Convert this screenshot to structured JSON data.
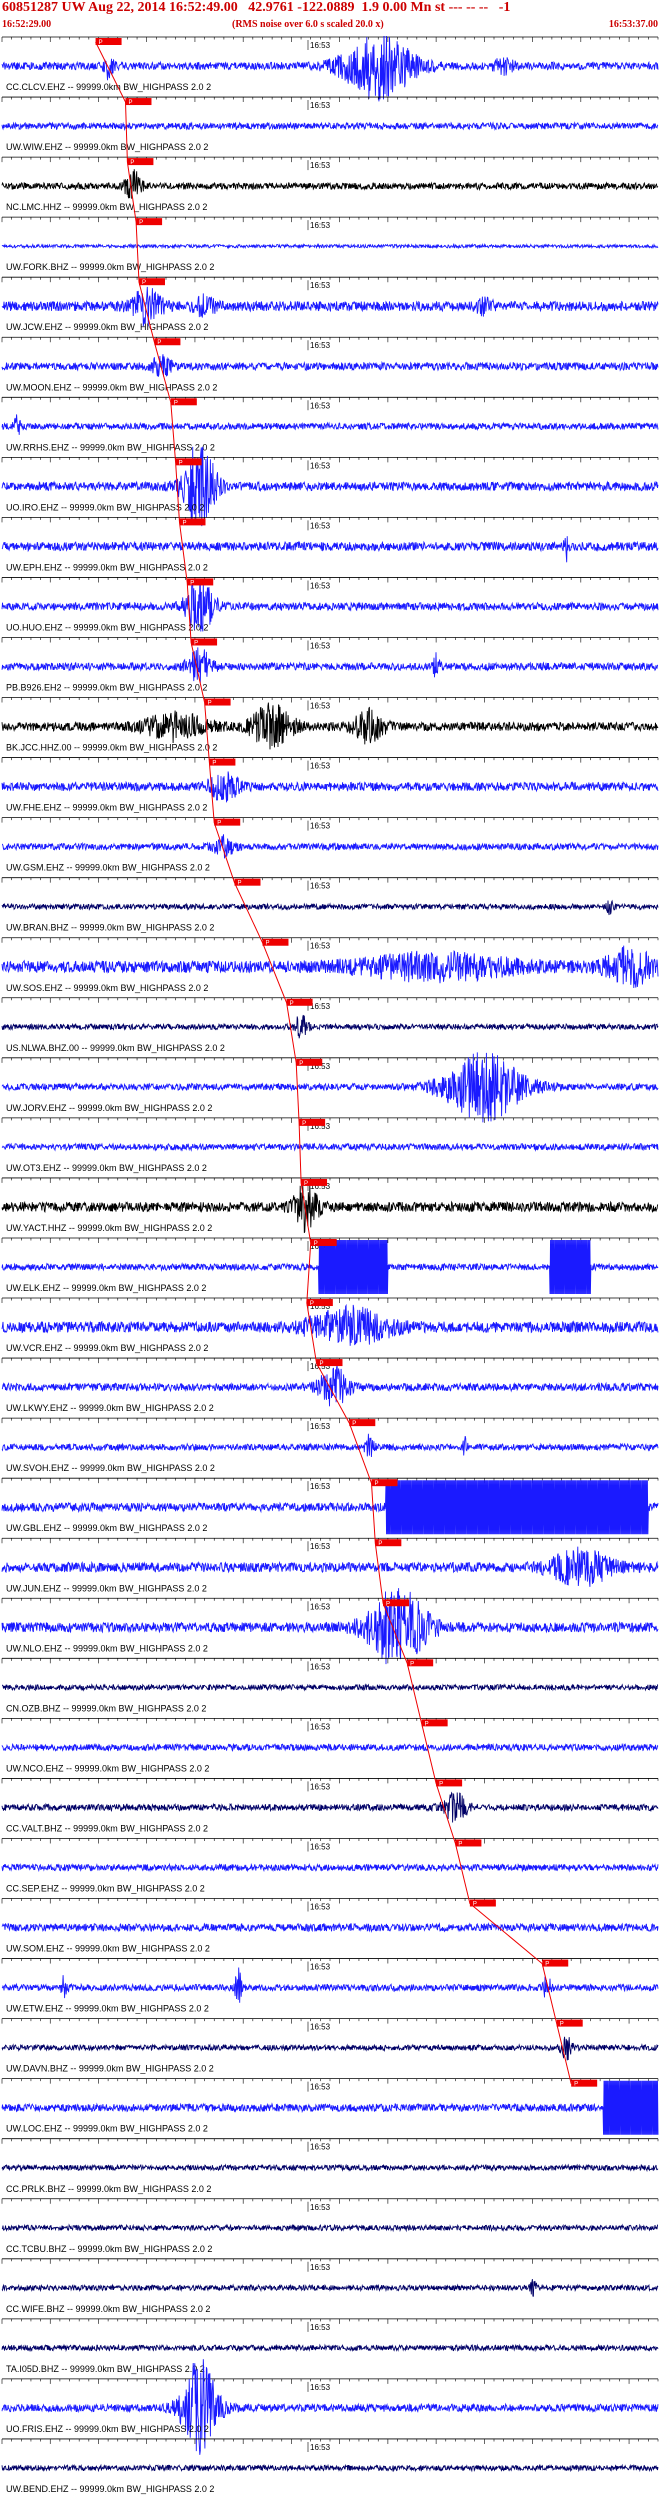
{
  "header": {
    "title": "60851287 UW Aug 22, 2014 16:52:49.00   42.9761 -122.0889  1.9 0.00 Mn st --- -- --   -1",
    "start_time": "16:52:29.00",
    "rms_note": "(RMS noise over 6.0 s scaled 20.0 x)",
    "end_time": "16:53:37.00"
  },
  "chart_data": {
    "type": "line",
    "title": "60851287 UW Aug 22, 2014 16:52:49.00   42.9761 -122.0889  1.9 0.00 Mn st --- -- --   -1",
    "x_start": "16:52:29.00",
    "x_end": "16:53:37.00",
    "x_duration_s": 68,
    "x_mid_label": "16:53",
    "pick_label": "P",
    "filter_label": "-- 99999.0km BW_HIGHPASS  2.0  2",
    "colors": {
      "blue": "#1a1aff",
      "black": "#000000",
      "navy": "#000066",
      "pick": "#ee0000"
    },
    "stations": [
      {
        "name": "CC.CLCV.EHZ",
        "pick_s": 9.7,
        "color": "#1a1aff",
        "amp": 0.35,
        "events": [
          {
            "t": 11,
            "a": 1.0,
            "w": 0.5
          },
          {
            "t": 39,
            "a": 3.0,
            "w": 3.5
          },
          {
            "t": 52,
            "a": 0.6,
            "w": 1
          }
        ]
      },
      {
        "name": "UW.WIW.EHZ",
        "pick_s": 12.8,
        "color": "#1a1aff",
        "amp": 0.3,
        "events": []
      },
      {
        "name": "NC.LMC.HHZ",
        "pick_s": 13.0,
        "color": "#000000",
        "amp": 0.3,
        "events": [
          {
            "t": 13.6,
            "a": 1.4,
            "w": 0.8
          }
        ]
      },
      {
        "name": "UW.FORK.BHZ",
        "pick_s": 13.9,
        "color": "#1a1aff",
        "amp": 0.15,
        "events": []
      },
      {
        "name": "UW.JCW.EHZ",
        "pick_s": 14.2,
        "color": "#1a1aff",
        "amp": 0.45,
        "events": [
          {
            "t": 15,
            "a": 1.5,
            "w": 1.5
          },
          {
            "t": 21,
            "a": 0.8,
            "w": 1
          },
          {
            "t": 50,
            "a": 0.6,
            "w": 0.8
          }
        ]
      },
      {
        "name": "UW.MOON.EHZ",
        "pick_s": 15.8,
        "color": "#1a1aff",
        "amp": 0.35,
        "events": [
          {
            "t": 16.5,
            "a": 0.8,
            "w": 1
          }
        ]
      },
      {
        "name": "UW.RRHS.EHZ",
        "pick_s": 17.5,
        "color": "#1a1aff",
        "amp": 0.3,
        "events": [
          {
            "t": 1.5,
            "a": 1.2,
            "w": 0.3
          }
        ]
      },
      {
        "name": "UO.IRO.EHZ",
        "pick_s": 18.0,
        "color": "#1a1aff",
        "amp": 0.4,
        "events": [
          {
            "t": 20.5,
            "a": 4.0,
            "w": 1.6
          }
        ]
      },
      {
        "name": "UW.EPH.EHZ",
        "pick_s": 18.4,
        "color": "#1a1aff",
        "amp": 0.4,
        "events": [
          {
            "t": 58.5,
            "a": 1.5,
            "w": 0.2
          }
        ]
      },
      {
        "name": "UO.HUO.EHZ",
        "pick_s": 19.2,
        "color": "#1a1aff",
        "amp": 0.35,
        "events": [
          {
            "t": 20.5,
            "a": 2.2,
            "w": 1.5
          }
        ]
      },
      {
        "name": "PB.B926.EH2",
        "pick_s": 19.6,
        "color": "#1a1aff",
        "amp": 0.35,
        "events": [
          {
            "t": 20.5,
            "a": 1.5,
            "w": 1.2
          },
          {
            "t": 45,
            "a": 1.2,
            "w": 0.3
          }
        ]
      },
      {
        "name": "BK.JCC.HHZ.00",
        "pick_s": 21.0,
        "color": "#000000",
        "amp": 0.4,
        "events": [
          {
            "t": 18,
            "a": 1.2,
            "w": 3
          },
          {
            "t": 28,
            "a": 2.0,
            "w": 2
          },
          {
            "t": 38,
            "a": 1.4,
            "w": 1.5
          }
        ]
      },
      {
        "name": "UW.FHE.EHZ",
        "pick_s": 21.5,
        "color": "#1a1aff",
        "amp": 0.4,
        "events": [
          {
            "t": 23,
            "a": 1.2,
            "w": 1.5
          }
        ]
      },
      {
        "name": "UW.GSM.EHZ",
        "pick_s": 22.0,
        "color": "#1a1aff",
        "amp": 0.3,
        "events": [
          {
            "t": 23,
            "a": 0.9,
            "w": 1
          }
        ]
      },
      {
        "name": "UW.BRAN.BHZ",
        "pick_s": 24.1,
        "color": "#000066",
        "amp": 0.25,
        "events": [
          {
            "t": 63,
            "a": 0.6,
            "w": 0.3
          }
        ]
      },
      {
        "name": "UW.SOS.EHZ",
        "pick_s": 27.0,
        "color": "#1a1aff",
        "amp": 0.55,
        "events": [
          {
            "t": 45,
            "a": 1.0,
            "w": 8
          },
          {
            "t": 65,
            "a": 1.5,
            "w": 2.5
          }
        ]
      },
      {
        "name": "US.NLWA.BHZ.00",
        "pick_s": 29.5,
        "color": "#000066",
        "amp": 0.25,
        "events": [
          {
            "t": 31,
            "a": 1.0,
            "w": 0.7
          }
        ]
      },
      {
        "name": "UW.JORV.EHZ",
        "pick_s": 30.5,
        "color": "#1a1aff",
        "amp": 0.3,
        "events": [
          {
            "t": 50,
            "a": 3.0,
            "w": 4
          }
        ]
      },
      {
        "name": "UW.OT3.EHZ",
        "pick_s": 30.8,
        "color": "#1a1aff",
        "amp": 0.3,
        "events": []
      },
      {
        "name": "UW.YACT.HHZ",
        "pick_s": 31.0,
        "color": "#000000",
        "amp": 0.45,
        "events": [
          {
            "t": 31.5,
            "a": 2.0,
            "w": 1.2
          }
        ]
      },
      {
        "name": "UW.ELK.EHZ",
        "pick_s": 32.0,
        "color": "#1a1aff",
        "amp": 0.3,
        "events": [
          {
            "t": 33,
            "a": 8.0,
            "w": 7,
            "clip": 1
          },
          {
            "t": 57,
            "a": 6.0,
            "w": 4,
            "clip": 1
          }
        ]
      },
      {
        "name": "UW.VCR.EHZ",
        "pick_s": 31.6,
        "color": "#1a1aff",
        "amp": 0.5,
        "events": [
          {
            "t": 36,
            "a": 1.6,
            "w": 4
          }
        ]
      },
      {
        "name": "UW.LKWY.EHZ",
        "pick_s": 32.6,
        "color": "#1a1aff",
        "amp": 0.35,
        "events": [
          {
            "t": 34.5,
            "a": 1.8,
            "w": 1.5
          }
        ]
      },
      {
        "name": "UW.SVOH.EHZ",
        "pick_s": 36.0,
        "color": "#1a1aff",
        "amp": 0.3,
        "events": [
          {
            "t": 38,
            "a": 1.2,
            "w": 0.5
          },
          {
            "t": 48,
            "a": 0.8,
            "w": 0.2
          }
        ]
      },
      {
        "name": "UW.GBL.EHZ",
        "pick_s": 38.3,
        "color": "#1a1aff",
        "amp": 0.4,
        "events": [
          {
            "t": 40,
            "a": 8.0,
            "w": 27,
            "clip": 1
          }
        ]
      },
      {
        "name": "UW.JUN.EHZ",
        "pick_s": 38.7,
        "color": "#1a1aff",
        "amp": 0.45,
        "events": [
          {
            "t": 60,
            "a": 1.6,
            "w": 3
          }
        ]
      },
      {
        "name": "UW.NLO.EHZ",
        "pick_s": 39.5,
        "color": "#1a1aff",
        "amp": 0.45,
        "events": [
          {
            "t": 41,
            "a": 3.5,
            "w": 3
          }
        ]
      },
      {
        "name": "CN.OZB.BHZ",
        "pick_s": 42.0,
        "color": "#000066",
        "amp": 0.25,
        "events": []
      },
      {
        "name": "UW.NCO.EHZ",
        "pick_s": 43.5,
        "color": "#1a1aff",
        "amp": 0.3,
        "events": []
      },
      {
        "name": "CC.VALT.BHZ",
        "pick_s": 45.0,
        "color": "#000066",
        "amp": 0.3,
        "events": [
          {
            "t": 47,
            "a": 1.2,
            "w": 1.2
          }
        ]
      },
      {
        "name": "CC.SEP.EHZ",
        "pick_s": 47.0,
        "color": "#1a1aff",
        "amp": 0.3,
        "events": []
      },
      {
        "name": "UW.SOM.EHZ",
        "pick_s": 48.5,
        "color": "#1a1aff",
        "amp": 0.35,
        "events": []
      },
      {
        "name": "UW.ETW.EHZ",
        "pick_s": 56.0,
        "color": "#1a1aff",
        "amp": 0.3,
        "events": [
          {
            "t": 6.5,
            "a": 1.2,
            "w": 0.3
          },
          {
            "t": 24.5,
            "a": 1.8,
            "w": 0.3
          },
          {
            "t": 56.5,
            "a": 1.0,
            "w": 0.4
          }
        ]
      },
      {
        "name": "UW.DAVN.BHZ",
        "pick_s": 57.5,
        "color": "#000066",
        "amp": 0.25,
        "events": [
          {
            "t": 58.5,
            "a": 1.0,
            "w": 0.6
          }
        ]
      },
      {
        "name": "UW.LOC.EHZ",
        "pick_s": 59.0,
        "color": "#1a1aff",
        "amp": 0.35,
        "events": [
          {
            "t": 62.5,
            "a": 8.0,
            "w": 6,
            "clip": 1
          }
        ]
      },
      {
        "name": "CC.PRLK.BHZ",
        "pick_s": null,
        "color": "#000066",
        "amp": 0.25,
        "events": []
      },
      {
        "name": "CC.TCBU.BHZ",
        "pick_s": null,
        "color": "#000066",
        "amp": 0.25,
        "events": []
      },
      {
        "name": "CC.WIFE.BHZ",
        "pick_s": null,
        "color": "#000066",
        "amp": 0.25,
        "events": [
          {
            "t": 55,
            "a": 0.6,
            "w": 0.4
          }
        ]
      },
      {
        "name": "TA.I05D.BHZ",
        "pick_s": null,
        "color": "#000066",
        "amp": 0.25,
        "events": []
      },
      {
        "name": "UO.FRIS.EHZ",
        "pick_s": null,
        "color": "#1a1aff",
        "amp": 0.35,
        "events": [
          {
            "t": 20.5,
            "a": 4.5,
            "w": 1.8
          }
        ]
      },
      {
        "name": "UW.BEND.EHZ",
        "pick_s": null,
        "color": "#000066",
        "amp": 0.25,
        "events": []
      }
    ]
  }
}
